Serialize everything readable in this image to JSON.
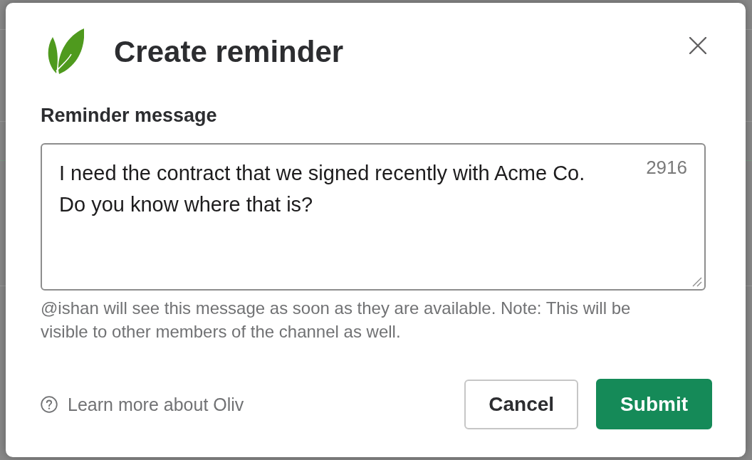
{
  "dialog": {
    "title": "Create reminder",
    "message_field": {
      "label": "Reminder message",
      "value": "I need the contract that we signed recently with Acme Co.\nDo you know where that is?",
      "counter": "2916",
      "hint": "@ishan will see this message as soon as they are available. Note: This will be visible to other members of the channel as well."
    },
    "help_link": "Learn more about Oliv",
    "buttons": [
      {
        "label": "Cancel",
        "kind": "secondary"
      },
      {
        "label": "Submit",
        "kind": "primary"
      }
    ]
  }
}
